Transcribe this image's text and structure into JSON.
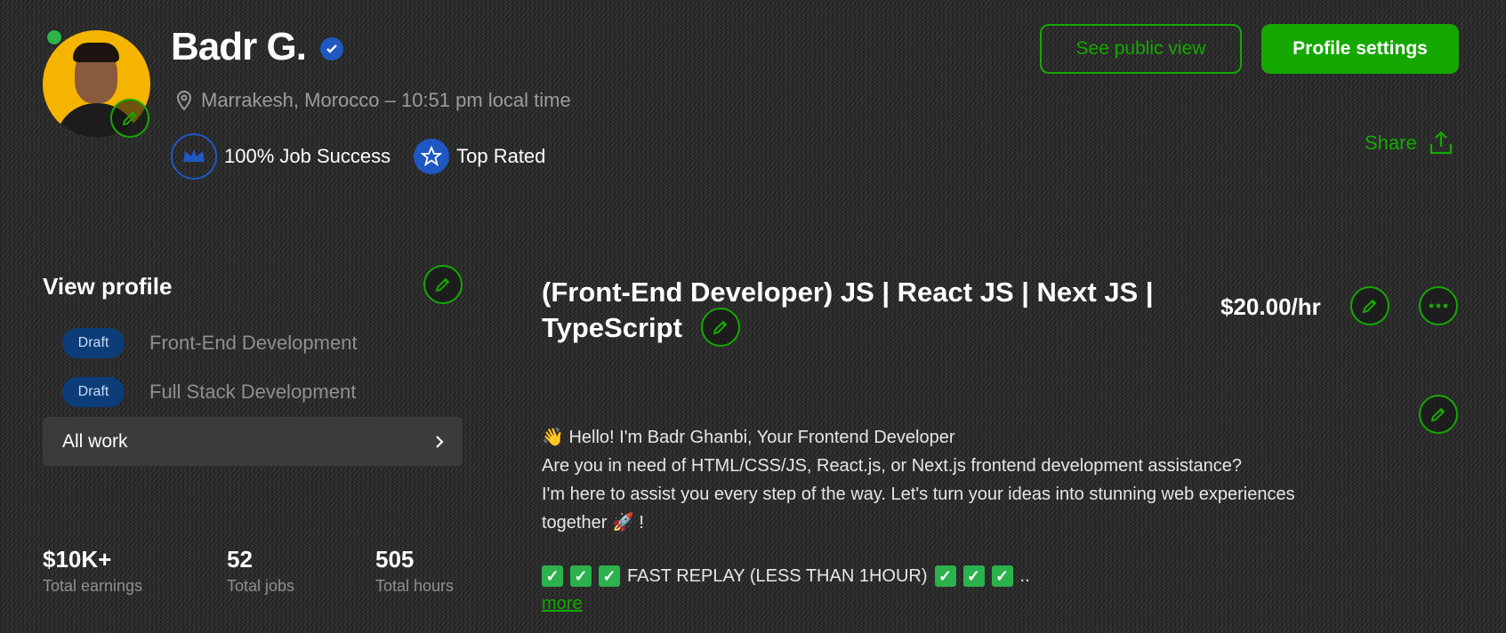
{
  "profile": {
    "name": "Badr G.",
    "location": "Marrakesh, Morocco – 10:51 pm local time",
    "badges": [
      {
        "label": "100% Job Success",
        "icon": "crown-icon"
      },
      {
        "label": "Top Rated",
        "icon": "star-icon"
      }
    ],
    "status_color": "#2db34a"
  },
  "actions": {
    "public_view": "See public view",
    "settings": "Profile settings",
    "share": "Share"
  },
  "sidebar": {
    "view_profile": "View profile",
    "specialized_profiles": [
      {
        "status": "Draft",
        "label": "Front-End Development"
      },
      {
        "status": "Draft",
        "label": "Full Stack Development"
      }
    ],
    "all_work": "All work"
  },
  "stats": [
    {
      "value": "$10K+",
      "label": "Total earnings"
    },
    {
      "value": "52",
      "label": "Total jobs"
    },
    {
      "value": "505",
      "label": "Total hours"
    }
  ],
  "main": {
    "title": "(Front-End Developer) JS | React JS | Next JS | TypeScript",
    "rate": "$20.00/hr",
    "overview_lines": [
      "👋 Hello! I'm Badr Ghanbi, Your Frontend Developer",
      "Are you in need of HTML/CSS/JS, React.js, or Next.js frontend development assistance?",
      "I'm here to assist you every step of the way. Let's turn your ideas into stunning web experiences",
      "together 🚀 !"
    ],
    "fast_reply": "FAST REPLAY (LESS THAN 1HOUR)",
    "ellipsis": "..",
    "more": "more"
  },
  "colors": {
    "accent": "#14a800",
    "badge_blue": "#1f57c3",
    "draft_bg": "#0d3d78"
  }
}
